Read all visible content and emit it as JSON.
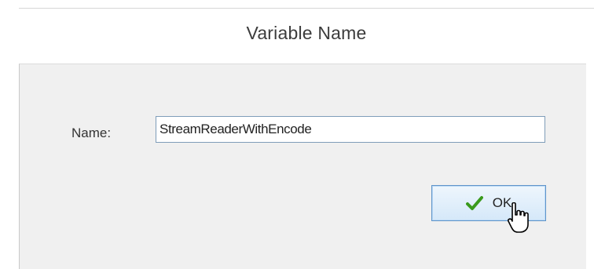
{
  "dialog": {
    "title": "Variable Name"
  },
  "form": {
    "name_label": "Name:",
    "name_value": "StreamReaderWithEncode"
  },
  "buttons": {
    "ok_label": "OK"
  },
  "icons": {
    "ok": "check-icon",
    "pointer": "mouse-pointer-icon"
  },
  "colors": {
    "check_green": "#3a9a1c",
    "button_border": "#5f94c9",
    "client_bg": "#f0f0f0"
  }
}
